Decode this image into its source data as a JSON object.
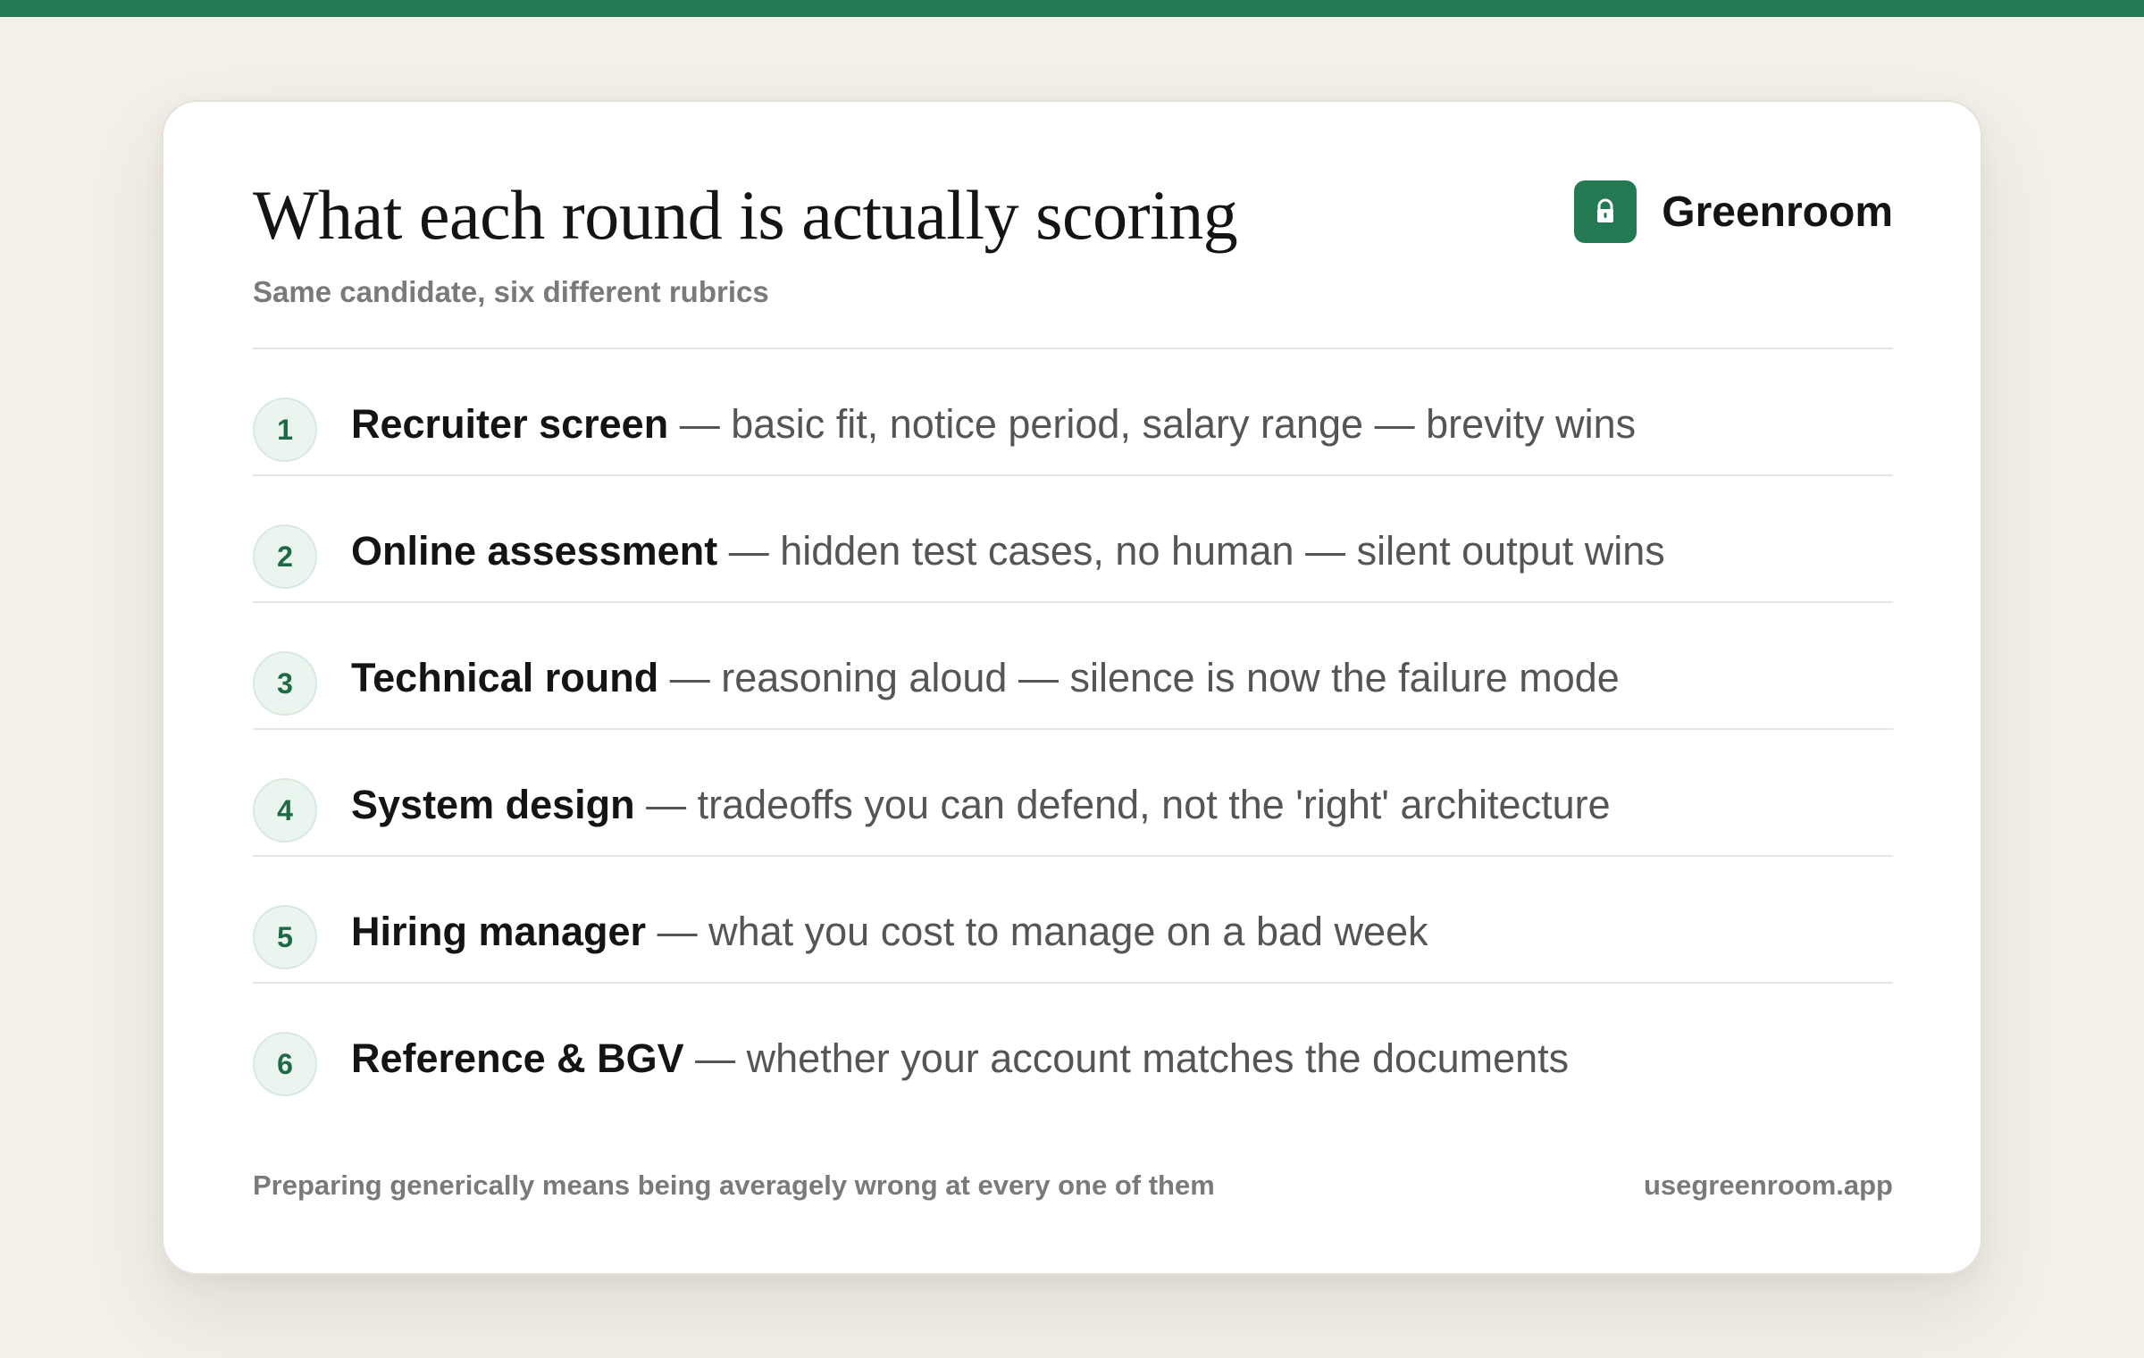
{
  "theme": {
    "accent": "#237a52",
    "background": "#f3f0e9",
    "card": "#ffffff"
  },
  "header": {
    "title": "What each round is actually scoring",
    "subtitle": "Same candidate, six different rubrics"
  },
  "brand": {
    "name": "Greenroom",
    "icon": "lock-icon"
  },
  "rounds": [
    {
      "number": "1",
      "title": "Recruiter screen",
      "description": " — basic fit, notice period, salary range — brevity wins"
    },
    {
      "number": "2",
      "title": "Online assessment",
      "description": " — hidden test cases, no human — silent output wins"
    },
    {
      "number": "3",
      "title": "Technical round",
      "description": " — reasoning aloud — silence is now the failure mode"
    },
    {
      "number": "4",
      "title": "System design",
      "description": " — tradeoffs you can defend, not the 'right' architecture"
    },
    {
      "number": "5",
      "title": "Hiring manager",
      "description": " — what you cost to manage on a bad week"
    },
    {
      "number": "6",
      "title": "Reference & BGV",
      "description": " — whether your account matches the documents"
    }
  ],
  "footer": {
    "note": "Preparing generically means being averagely wrong at every one of them",
    "url": "usegreenroom.app"
  }
}
